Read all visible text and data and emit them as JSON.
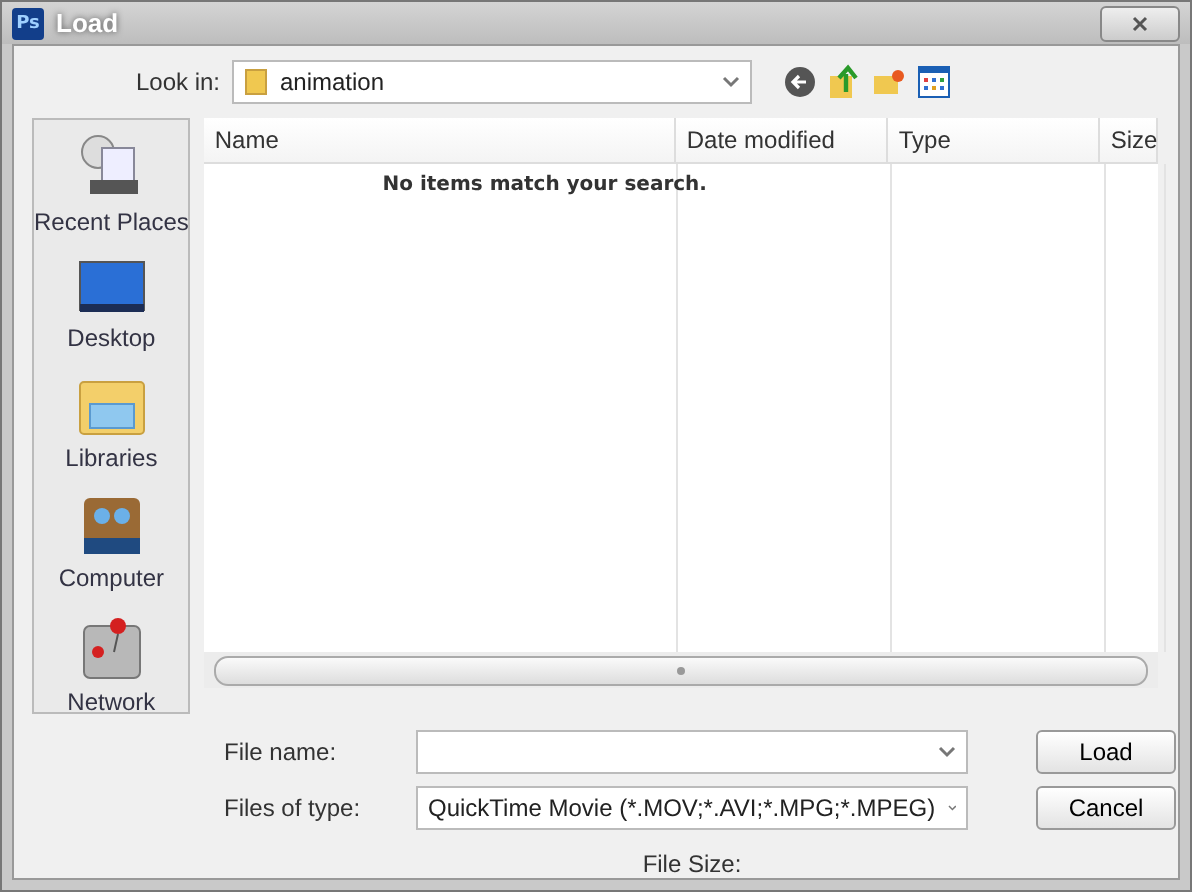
{
  "window": {
    "app_badge": "Ps",
    "title": "Load"
  },
  "look_in": {
    "label": "Look in:",
    "value": "animation"
  },
  "places": [
    {
      "kind": "recent",
      "label": "Recent Places"
    },
    {
      "kind": "desktop",
      "label": "Desktop"
    },
    {
      "kind": "libraries",
      "label": "Libraries"
    },
    {
      "kind": "computer",
      "label": "Computer"
    },
    {
      "kind": "network",
      "label": "Network"
    }
  ],
  "table": {
    "columns": [
      "Name",
      "Date modified",
      "Type",
      "Size"
    ],
    "empty_message": "No items match your search."
  },
  "file_name": {
    "label": "File name:"
  },
  "file_type": {
    "label": "Files of type:",
    "value": "QuickTime Movie (*.MOV;*.AVI;*.MPG;*.MPEG)"
  },
  "file_size": {
    "label": "File Size:"
  },
  "buttons": [
    "Load",
    "Cancel"
  ]
}
